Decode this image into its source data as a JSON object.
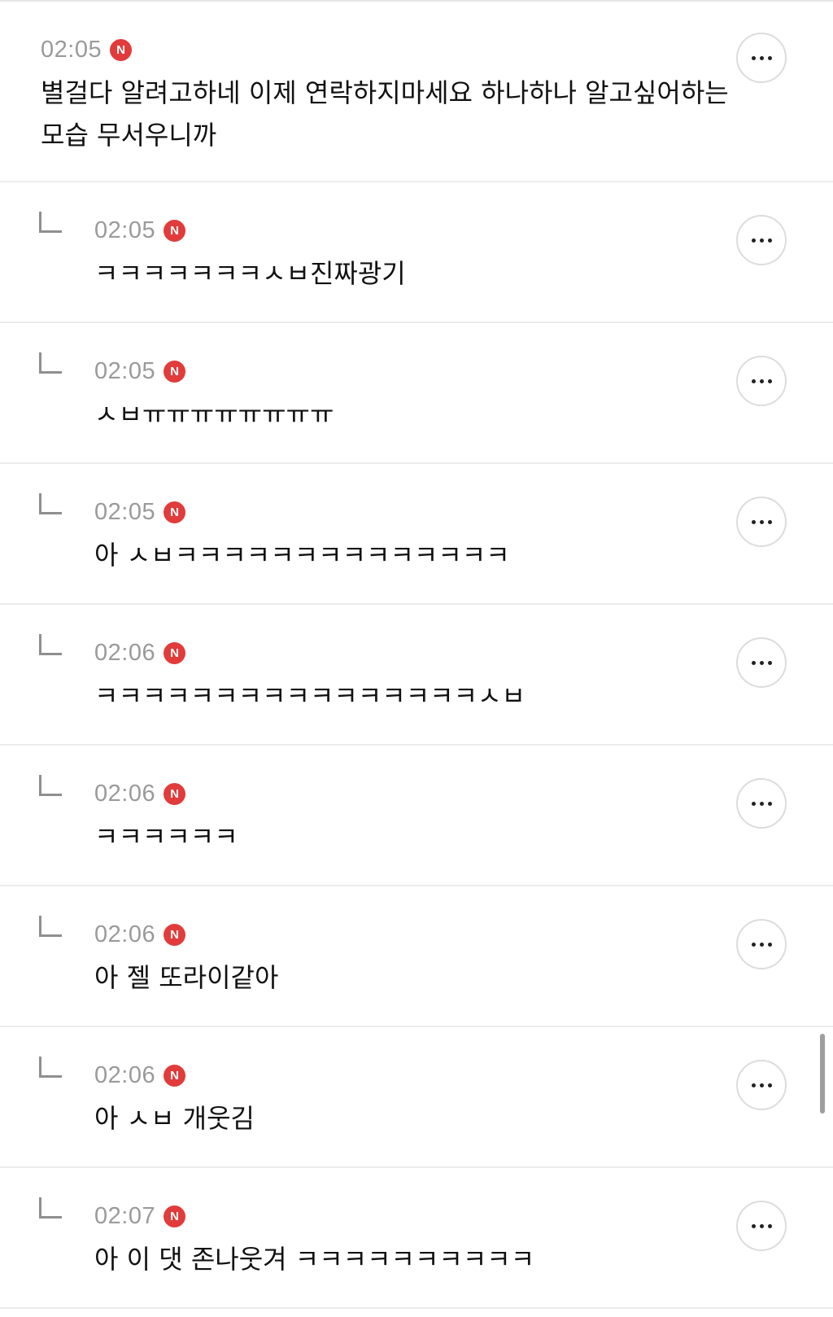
{
  "comments": [
    {
      "time": "02:05",
      "badge": "N",
      "text": "별걸다 알려고하네 이제 연락하지마세요 하나하나 알고싶어하는 모습 무서우니까"
    },
    {
      "time": "02:05",
      "badge": "N",
      "text": "ㅋㅋㅋㅋㅋㅋㅋㅅㅂ진짜광기"
    },
    {
      "time": "02:05",
      "badge": "N",
      "text": "ㅅㅂㅠㅠㅠㅠㅠㅠㅠㅠ"
    },
    {
      "time": "02:05",
      "badge": "N",
      "text": "아 ㅅㅂㅋㅋㅋㅋㅋㅋㅋㅋㅋㅋㅋㅋㅋㅋ"
    },
    {
      "time": "02:06",
      "badge": "N",
      "text": "ㅋㅋㅋㅋㅋㅋㅋㅋㅋㅋㅋㅋㅋㅋㅋㅋㅅㅂ"
    },
    {
      "time": "02:06",
      "badge": "N",
      "text": "ㅋㅋㅋㅋㅋㅋ"
    },
    {
      "time": "02:06",
      "badge": "N",
      "text": "아 젤 또라이같아"
    },
    {
      "time": "02:06",
      "badge": "N",
      "text": "아 ㅅㅂ 개웃김"
    },
    {
      "time": "02:07",
      "badge": "N",
      "text": "아 이 댓 존나웃겨 ㅋㅋㅋㅋㅋㅋㅋㅋㅋㅋ"
    }
  ],
  "icons": {
    "reply": "reply-arrow-icon",
    "more": "more-options-icon",
    "new": "new-badge-icon"
  },
  "colors": {
    "badge": "#e23b3b",
    "time": "#9a9a9a",
    "text": "#111111",
    "divider": "#ececec"
  }
}
